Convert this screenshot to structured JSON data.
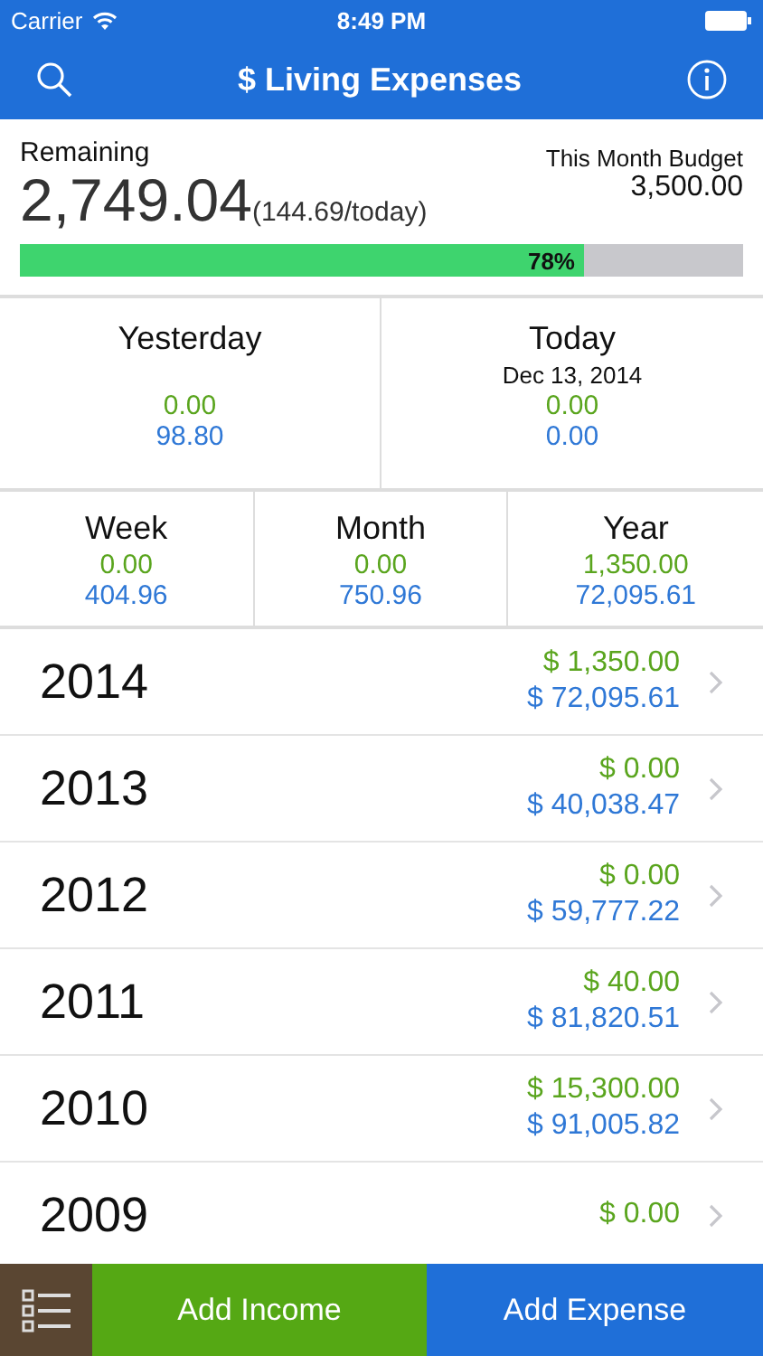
{
  "status_bar": {
    "carrier": "Carrier",
    "time": "8:49 PM"
  },
  "nav": {
    "title": "$ Living Expenses"
  },
  "summary": {
    "remaining_label": "Remaining",
    "remaining": "2,749.04",
    "per_day": "(144.69/today)",
    "budget_label": "This Month Budget",
    "budget": "3,500.00",
    "level": 0.78,
    "percent": "78%"
  },
  "days": [
    {
      "label": "Yesterday",
      "income": "0.00",
      "expense": "98.80"
    },
    {
      "label": "Today",
      "date": "Dec 13, 2014",
      "income": "0.00",
      "expense": "0.00"
    }
  ],
  "periods": [
    {
      "label": "Week",
      "income": "0.00",
      "expense": "404.96"
    },
    {
      "label": "Month",
      "income": "0.00",
      "expense": "750.96"
    },
    {
      "label": "Year",
      "income": "1,350.00",
      "expense": "72,095.61"
    }
  ],
  "years": [
    {
      "year": "2014",
      "income": "$ 1,350.00",
      "expense": "$ 72,095.61"
    },
    {
      "year": "2013",
      "income": "$ 0.00",
      "expense": "$ 40,038.47"
    },
    {
      "year": "2012",
      "income": "$ 0.00",
      "expense": "$ 59,777.22"
    },
    {
      "year": "2011",
      "income": "$ 40.00",
      "expense": "$ 81,820.51"
    },
    {
      "year": "2010",
      "income": "$ 15,300.00",
      "expense": "$ 91,005.82"
    },
    {
      "year": "2009",
      "income": "$ 0.00"
    }
  ],
  "toolbar": {
    "income_button": "Add Income",
    "expense_button": "Add Expense"
  }
}
